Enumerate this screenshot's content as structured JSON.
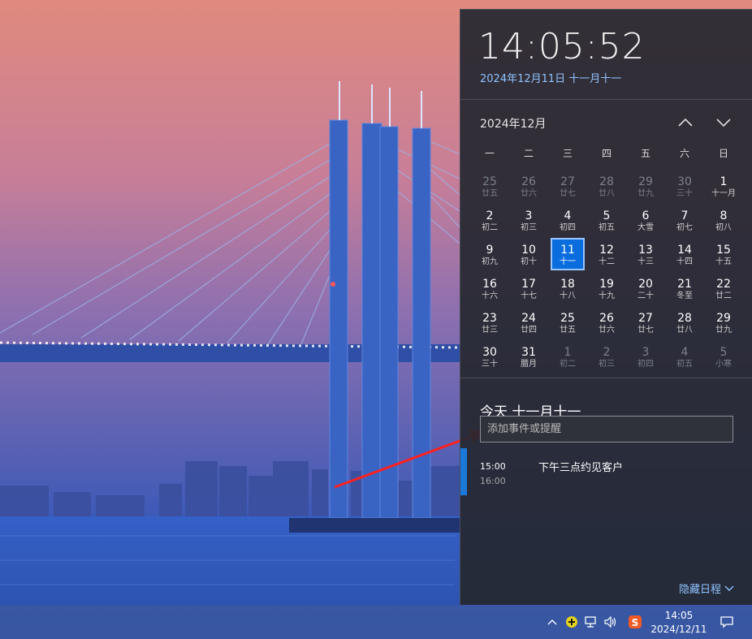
{
  "flyout": {
    "clock": "14:05:52",
    "full_date": "2024年12月11日 十一月十一",
    "month_title": "2024年12月",
    "weekdays": [
      "一",
      "二",
      "三",
      "四",
      "五",
      "六",
      "日"
    ],
    "days": [
      {
        "num": "25",
        "lunar": "廿五",
        "other": true
      },
      {
        "num": "26",
        "lunar": "廿六",
        "other": true
      },
      {
        "num": "27",
        "lunar": "廿七",
        "other": true
      },
      {
        "num": "28",
        "lunar": "廿八",
        "other": true
      },
      {
        "num": "29",
        "lunar": "廿九",
        "other": true
      },
      {
        "num": "30",
        "lunar": "三十",
        "other": true
      },
      {
        "num": "1",
        "lunar": "十一月"
      },
      {
        "num": "2",
        "lunar": "初二"
      },
      {
        "num": "3",
        "lunar": "初三"
      },
      {
        "num": "4",
        "lunar": "初四"
      },
      {
        "num": "5",
        "lunar": "初五"
      },
      {
        "num": "6",
        "lunar": "大雪"
      },
      {
        "num": "7",
        "lunar": "初七"
      },
      {
        "num": "8",
        "lunar": "初八"
      },
      {
        "num": "9",
        "lunar": "初九"
      },
      {
        "num": "10",
        "lunar": "初十"
      },
      {
        "num": "11",
        "lunar": "十一",
        "today": true
      },
      {
        "num": "12",
        "lunar": "十二"
      },
      {
        "num": "13",
        "lunar": "十三"
      },
      {
        "num": "14",
        "lunar": "十四"
      },
      {
        "num": "15",
        "lunar": "十五"
      },
      {
        "num": "16",
        "lunar": "十六"
      },
      {
        "num": "17",
        "lunar": "十七"
      },
      {
        "num": "18",
        "lunar": "十八"
      },
      {
        "num": "19",
        "lunar": "十九"
      },
      {
        "num": "20",
        "lunar": "二十"
      },
      {
        "num": "21",
        "lunar": "冬至"
      },
      {
        "num": "22",
        "lunar": "廿二"
      },
      {
        "num": "23",
        "lunar": "廿三"
      },
      {
        "num": "24",
        "lunar": "廿四"
      },
      {
        "num": "25",
        "lunar": "廿五"
      },
      {
        "num": "26",
        "lunar": "廿六"
      },
      {
        "num": "27",
        "lunar": "廿七"
      },
      {
        "num": "28",
        "lunar": "廿八"
      },
      {
        "num": "29",
        "lunar": "廿九"
      },
      {
        "num": "30",
        "lunar": "三十"
      },
      {
        "num": "31",
        "lunar": "腊月"
      },
      {
        "num": "1",
        "lunar": "初二",
        "other": true
      },
      {
        "num": "2",
        "lunar": "初三",
        "other": true
      },
      {
        "num": "3",
        "lunar": "初四",
        "other": true
      },
      {
        "num": "4",
        "lunar": "初五",
        "other": true
      },
      {
        "num": "5",
        "lunar": "小寒",
        "other": true
      }
    ],
    "agenda_title": "今天 十一月十一",
    "event_input_placeholder": "添加事件或提醒",
    "event": {
      "start": "15:00",
      "end": "16:00",
      "title": "下午三点约见客户"
    },
    "hide_agenda": "隐藏日程",
    "accent_color": "#0a6dde"
  },
  "taskbar": {
    "time": "14:05",
    "date": "2024/12/11",
    "icons": [
      "chevron-up-icon",
      "add-app-icon",
      "network-icon",
      "volume-icon",
      "sogou-ime-icon",
      "notification-icon"
    ]
  }
}
